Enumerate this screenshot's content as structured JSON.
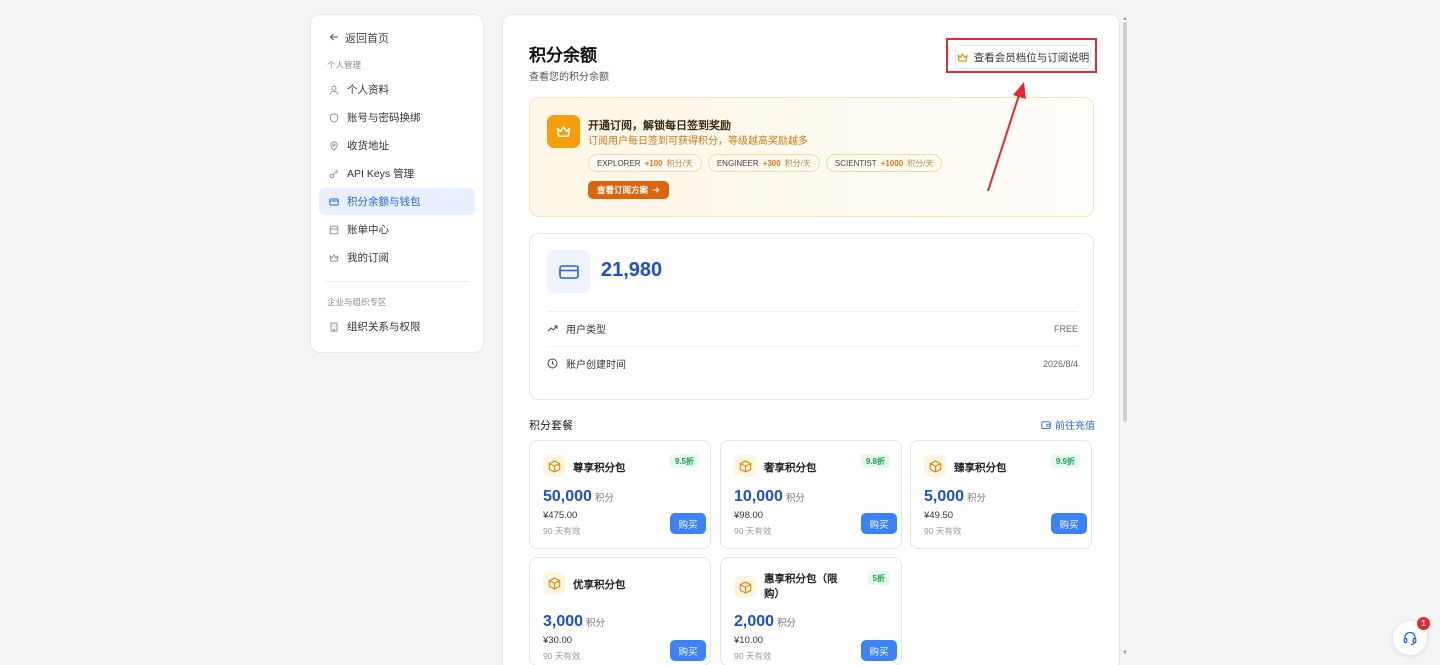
{
  "sidebar": {
    "back_label": "返回首页",
    "section_personal": "个人管理",
    "items": [
      {
        "label": "个人资料",
        "icon": "user-icon"
      },
      {
        "label": "账号与密码换绑",
        "icon": "shield-icon"
      },
      {
        "label": "收货地址",
        "icon": "location-pin-icon"
      },
      {
        "label": "API Keys 管理",
        "icon": "key-icon"
      },
      {
        "label": "积分余额与钱包",
        "icon": "credit-card-icon",
        "active": true
      },
      {
        "label": "账单中心",
        "icon": "receipt-icon"
      },
      {
        "label": "我的订阅",
        "icon": "crown-icon"
      }
    ],
    "section_enterprise": "企业与组织专区",
    "enterprise_items": [
      {
        "label": "组织关系与权限",
        "icon": "building-icon"
      }
    ]
  },
  "header": {
    "title": "积分余额",
    "subtitle": "查看您的积分余额",
    "help_button": "查看会员档位与订阅说明"
  },
  "promo": {
    "title": "开通订阅，解锁每日签到奖励",
    "desc": "订阅用户每日签到可获得积分，等级越高奖励越多",
    "tiers": [
      {
        "name": "EXPLORER",
        "bonus": "+100",
        "unit": "积分/天"
      },
      {
        "name": "ENGINEER",
        "bonus": "+300",
        "unit": "积分/天"
      },
      {
        "name": "SCIENTIST",
        "bonus": "+1000",
        "unit": "积分/天"
      }
    ],
    "cta": "查看订阅方案"
  },
  "balance": {
    "amount": "21,980",
    "rows": [
      {
        "label": "用户类型",
        "value": "FREE"
      },
      {
        "label": "账户创建时间",
        "value": "2026/8/4"
      }
    ]
  },
  "packages": {
    "heading": "积分套餐",
    "link": "前往充值",
    "unit": "积分",
    "buy_label": "购买",
    "items": [
      {
        "name": "尊享积分包",
        "badge": "9.5折",
        "amount": "50,000",
        "price": "¥475.00",
        "valid": "90 天有效"
      },
      {
        "name": "奢享积分包",
        "badge": "9.8折",
        "amount": "10,000",
        "price": "¥98.00",
        "valid": "90 天有效"
      },
      {
        "name": "臻享积分包",
        "badge": "9.9折",
        "amount": "5,000",
        "price": "¥49.50",
        "valid": "90 天有效"
      },
      {
        "name": "优享积分包",
        "badge": "",
        "amount": "3,000",
        "price": "¥30.00",
        "valid": "90 天有效"
      },
      {
        "name": "惠享积分包（限购）",
        "badge": "5折",
        "amount": "2,000",
        "price": "¥10.00",
        "valid": "90 天有效"
      }
    ]
  },
  "support": {
    "notification_count": "1"
  },
  "colors": {
    "accent": "#2563eb",
    "promo_orange": "#d9660c",
    "highlight_red": "#e8282b"
  }
}
